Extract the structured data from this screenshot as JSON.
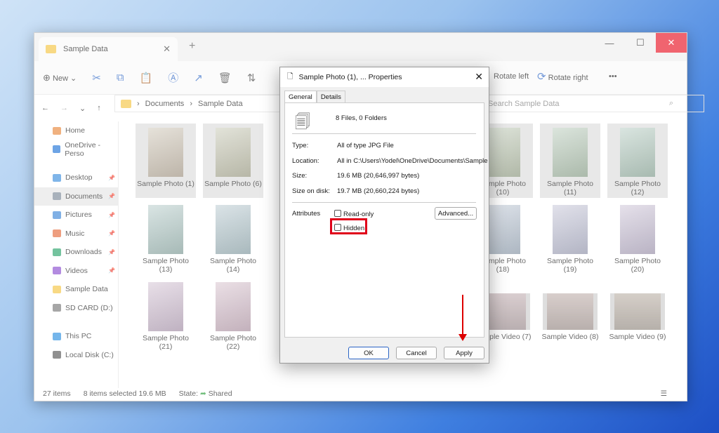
{
  "window": {
    "tab_title": "Sample Data",
    "minimize": "—",
    "maximize": "☐",
    "close": "✕"
  },
  "toolbar": {
    "new_label": "New",
    "rotate_left": "Rotate left",
    "rotate_right": "Rotate right",
    "more": "•••"
  },
  "nav": {
    "breadcrumb": [
      "Documents",
      "Sample Data"
    ],
    "search_placeholder": "Search Sample Data"
  },
  "sidebar": {
    "items": [
      {
        "label": "Home",
        "color": "#e8873b",
        "pinned": false,
        "selected": false
      },
      {
        "label": "OneDrive - Perso",
        "color": "#1f73d8",
        "pinned": false,
        "selected": false
      },
      {
        "label": "",
        "color": "",
        "pinned": false,
        "selected": false
      },
      {
        "label": "Desktop",
        "color": "#3b8ede",
        "pinned": true,
        "selected": false
      },
      {
        "label": "Documents",
        "color": "#7a8897",
        "pinned": true,
        "selected": true
      },
      {
        "label": "Pictures",
        "color": "#3c86d8",
        "pinned": true,
        "selected": false
      },
      {
        "label": "Music",
        "color": "#e56a3b",
        "pinned": true,
        "selected": false
      },
      {
        "label": "Downloads",
        "color": "#2aa36a",
        "pinned": true,
        "selected": false
      },
      {
        "label": "Videos",
        "color": "#8a4ed0",
        "pinned": true,
        "selected": false
      },
      {
        "label": "Sample Data",
        "color": "#f4c542",
        "pinned": false,
        "selected": false
      },
      {
        "label": "SD CARD (D:)",
        "color": "#777",
        "pinned": false,
        "selected": false
      },
      {
        "label": "",
        "color": "",
        "pinned": false,
        "selected": false
      },
      {
        "label": "This PC",
        "color": "#2c8fe0",
        "pinned": false,
        "selected": false
      },
      {
        "label": "Local Disk (C:)",
        "color": "#555",
        "pinned": false,
        "selected": false
      }
    ]
  },
  "files": [
    {
      "name": "Sample Photo (1)",
      "col": 0,
      "row": 0,
      "selected": true,
      "type": "photo"
    },
    {
      "name": "Sample Photo (6)",
      "col": 1,
      "row": 0,
      "selected": true,
      "type": "photo"
    },
    {
      "name": "Sample Photo (10)",
      "col": 5,
      "row": 0,
      "selected": true,
      "type": "photo"
    },
    {
      "name": "Sample Photo (11)",
      "col": 6,
      "row": 0,
      "selected": true,
      "type": "photo"
    },
    {
      "name": "Sample Photo (12)",
      "col": 7,
      "row": 0,
      "selected": true,
      "type": "photo"
    },
    {
      "name": "Sample Photo (13)",
      "col": 0,
      "row": 1,
      "selected": false,
      "type": "photo"
    },
    {
      "name": "Sample Photo (14)",
      "col": 1,
      "row": 1,
      "selected": false,
      "type": "photo"
    },
    {
      "name": "Sample Photo (18)",
      "col": 5,
      "row": 1,
      "selected": false,
      "type": "photo"
    },
    {
      "name": "Sample Photo (19)",
      "col": 6,
      "row": 1,
      "selected": false,
      "type": "photo"
    },
    {
      "name": "Sample Photo (20)",
      "col": 7,
      "row": 1,
      "selected": false,
      "type": "photo"
    },
    {
      "name": "Sample Photo (21)",
      "col": 0,
      "row": 2,
      "selected": false,
      "type": "photo"
    },
    {
      "name": "Sample Photo (22)",
      "col": 1,
      "row": 2,
      "selected": false,
      "type": "photo"
    },
    {
      "name": "Sample Video (7)",
      "col": 5,
      "row": 2,
      "selected": false,
      "type": "video"
    },
    {
      "name": "Sample Video (8)",
      "col": 6,
      "row": 2,
      "selected": false,
      "type": "video"
    },
    {
      "name": "Sample Video (9)",
      "col": 7,
      "row": 2,
      "selected": false,
      "type": "video"
    }
  ],
  "status": {
    "count": "27 items",
    "selected": "8 items selected",
    "size": "19.6 MB",
    "state_label": "State:",
    "state_value": "Shared"
  },
  "dialog": {
    "title": "Sample Photo (1), ... Properties",
    "tabs": [
      "General",
      "Details"
    ],
    "summary": "8 Files, 0 Folders",
    "type_label": "Type:",
    "type_value": "All of type JPG File",
    "location_label": "Location:",
    "location_value": "All in C:\\Users\\Yodel\\OneDrive\\Documents\\Sample",
    "size_label": "Size:",
    "size_value": "19.6 MB (20,646,997 bytes)",
    "disk_label": "Size on disk:",
    "disk_value": "19.7 MB (20,660,224 bytes)",
    "attributes_label": "Attributes",
    "readonly_label": "Read-only",
    "hidden_label": "Hidden",
    "readonly_checked": false,
    "hidden_checked": false,
    "advanced": "Advanced...",
    "ok": "OK",
    "cancel": "Cancel",
    "apply": "Apply"
  },
  "colors": {
    "highlight": "#e0001a",
    "accent": "#2a64c5"
  }
}
